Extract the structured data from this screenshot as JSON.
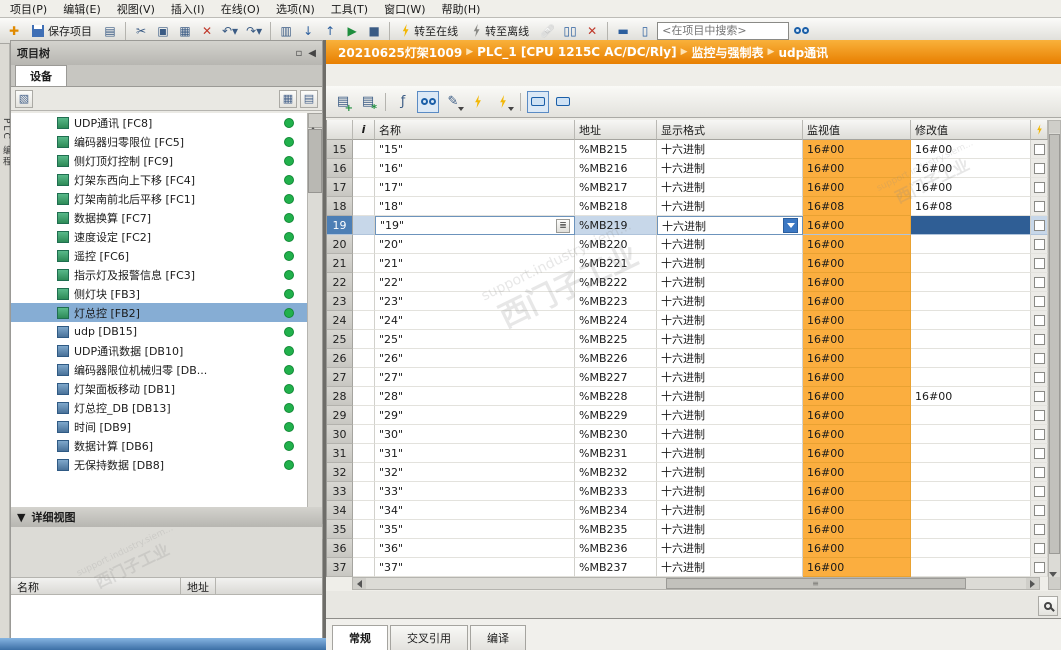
{
  "menu": {
    "items": [
      "项目(P)",
      "编辑(E)",
      "视图(V)",
      "插入(I)",
      "在线(O)",
      "选项(N)",
      "工具(T)",
      "窗口(W)",
      "帮助(H)"
    ]
  },
  "toolbar": {
    "save": "保存项目",
    "online": "转至在线",
    "offline": "转至离线",
    "search_placeholder": "<在项目中搜索>"
  },
  "side_tab": {
    "label": "PLC 编程"
  },
  "project_tree": {
    "title": "项目树",
    "tab_device": "设备",
    "items": [
      {
        "label": "UDP通讯 [FC8]",
        "kind": "FC",
        "selected": false
      },
      {
        "label": "编码器归零限位 [FC5]",
        "kind": "FC",
        "selected": false
      },
      {
        "label": "侧灯顶灯控制 [FC9]",
        "kind": "FC",
        "selected": false
      },
      {
        "label": "灯架东西向上下移 [FC4]",
        "kind": "FC",
        "selected": false
      },
      {
        "label": "灯架南前北后平移 [FC1]",
        "kind": "FC",
        "selected": false
      },
      {
        "label": "数据换算 [FC7]",
        "kind": "FC",
        "selected": false
      },
      {
        "label": "速度设定 [FC2]",
        "kind": "FC",
        "selected": false
      },
      {
        "label": "遥控 [FC6]",
        "kind": "FC",
        "selected": false
      },
      {
        "label": "指示灯及报警信息 [FC3]",
        "kind": "FC",
        "selected": false
      },
      {
        "label": "侧灯块 [FB3]",
        "kind": "FB",
        "selected": false
      },
      {
        "label": "灯总控 [FB2]",
        "kind": "FB",
        "selected": true
      },
      {
        "label": "udp [DB15]",
        "kind": "DB",
        "selected": false
      },
      {
        "label": "UDP通讯数据 [DB10]",
        "kind": "DB",
        "selected": false
      },
      {
        "label": "编码器限位机械归零 [DB...",
        "kind": "DB",
        "selected": false
      },
      {
        "label": "灯架面板移动 [DB1]",
        "kind": "DB",
        "selected": false
      },
      {
        "label": "灯总控_DB [DB13]",
        "kind": "DB",
        "selected": false
      },
      {
        "label": "时间 [DB9]",
        "kind": "DB",
        "selected": false
      },
      {
        "label": "数据计算 [DB6]",
        "kind": "DB",
        "selected": false
      },
      {
        "label": "无保持数据 [DB8]",
        "kind": "DB",
        "selected": false
      }
    ]
  },
  "detail_view": {
    "title": "详细视图",
    "col_name": "名称",
    "col_addr": "地址"
  },
  "breadcrumb": {
    "sep": "▶",
    "items": [
      "20210625灯架1009",
      "PLC_1 [CPU 1215C AC/DC/Rly]",
      "监控与强制表",
      "udp通讯"
    ]
  },
  "watch_table": {
    "headers": {
      "i": "i",
      "name": "名称",
      "address": "地址",
      "format": "显示格式",
      "monitor": "监视值",
      "modify": "修改值"
    },
    "rows": [
      {
        "n": "15",
        "name": "\"15\"",
        "addr": "%MB215",
        "fmt": "十六进制",
        "mon": "16#00",
        "mod": "16#00",
        "selected": false
      },
      {
        "n": "16",
        "name": "\"16\"",
        "addr": "%MB216",
        "fmt": "十六进制",
        "mon": "16#00",
        "mod": "16#00",
        "selected": false
      },
      {
        "n": "17",
        "name": "\"17\"",
        "addr": "%MB217",
        "fmt": "十六进制",
        "mon": "16#00",
        "mod": "16#00",
        "selected": false
      },
      {
        "n": "18",
        "name": "\"18\"",
        "addr": "%MB218",
        "fmt": "十六进制",
        "mon": "16#08",
        "mod": "16#08",
        "selected": false
      },
      {
        "n": "19",
        "name": "\"19\"",
        "addr": "%MB219",
        "fmt": "十六进制",
        "mon": "16#00",
        "mod": "",
        "selected": true
      },
      {
        "n": "20",
        "name": "\"20\"",
        "addr": "%MB220",
        "fmt": "十六进制",
        "mon": "16#00",
        "mod": "",
        "selected": false
      },
      {
        "n": "21",
        "name": "\"21\"",
        "addr": "%MB221",
        "fmt": "十六进制",
        "mon": "16#00",
        "mod": "",
        "selected": false
      },
      {
        "n": "22",
        "name": "\"22\"",
        "addr": "%MB222",
        "fmt": "十六进制",
        "mon": "16#00",
        "mod": "",
        "selected": false
      },
      {
        "n": "23",
        "name": "\"23\"",
        "addr": "%MB223",
        "fmt": "十六进制",
        "mon": "16#00",
        "mod": "",
        "selected": false
      },
      {
        "n": "24",
        "name": "\"24\"",
        "addr": "%MB224",
        "fmt": "十六进制",
        "mon": "16#00",
        "mod": "",
        "selected": false
      },
      {
        "n": "25",
        "name": "\"25\"",
        "addr": "%MB225",
        "fmt": "十六进制",
        "mon": "16#00",
        "mod": "",
        "selected": false
      },
      {
        "n": "26",
        "name": "\"26\"",
        "addr": "%MB226",
        "fmt": "十六进制",
        "mon": "16#00",
        "mod": "",
        "selected": false
      },
      {
        "n": "27",
        "name": "\"27\"",
        "addr": "%MB227",
        "fmt": "十六进制",
        "mon": "16#00",
        "mod": "",
        "selected": false
      },
      {
        "n": "28",
        "name": "\"28\"",
        "addr": "%MB228",
        "fmt": "十六进制",
        "mon": "16#00",
        "mod": "16#00",
        "selected": false
      },
      {
        "n": "29",
        "name": "\"29\"",
        "addr": "%MB229",
        "fmt": "十六进制",
        "mon": "16#00",
        "mod": "",
        "selected": false
      },
      {
        "n": "30",
        "name": "\"30\"",
        "addr": "%MB230",
        "fmt": "十六进制",
        "mon": "16#00",
        "mod": "",
        "selected": false
      },
      {
        "n": "31",
        "name": "\"31\"",
        "addr": "%MB231",
        "fmt": "十六进制",
        "mon": "16#00",
        "mod": "",
        "selected": false
      },
      {
        "n": "32",
        "name": "\"32\"",
        "addr": "%MB232",
        "fmt": "十六进制",
        "mon": "16#00",
        "mod": "",
        "selected": false
      },
      {
        "n": "33",
        "name": "\"33\"",
        "addr": "%MB233",
        "fmt": "十六进制",
        "mon": "16#00",
        "mod": "",
        "selected": false
      },
      {
        "n": "34",
        "name": "\"34\"",
        "addr": "%MB234",
        "fmt": "十六进制",
        "mon": "16#00",
        "mod": "",
        "selected": false
      },
      {
        "n": "35",
        "name": "\"35\"",
        "addr": "%MB235",
        "fmt": "十六进制",
        "mon": "16#00",
        "mod": "",
        "selected": false
      },
      {
        "n": "36",
        "name": "\"36\"",
        "addr": "%MB236",
        "fmt": "十六进制",
        "mon": "16#00",
        "mod": "",
        "selected": false
      },
      {
        "n": "37",
        "name": "\"37\"",
        "addr": "%MB237",
        "fmt": "十六进制",
        "mon": "16#00",
        "mod": "",
        "selected": false
      }
    ]
  },
  "bottom_tabs": {
    "items": [
      "常规",
      "交叉引用",
      "编译"
    ],
    "active": 0
  },
  "watermark": {
    "line1": "西门子工业",
    "line2": "support.industry.siem..."
  },
  "colors": {
    "accent_orange": "#E87F00",
    "monitor_cell": "#FBAE3F",
    "status_green": "#21B14C",
    "selection_blue": "#4D7FB5"
  }
}
